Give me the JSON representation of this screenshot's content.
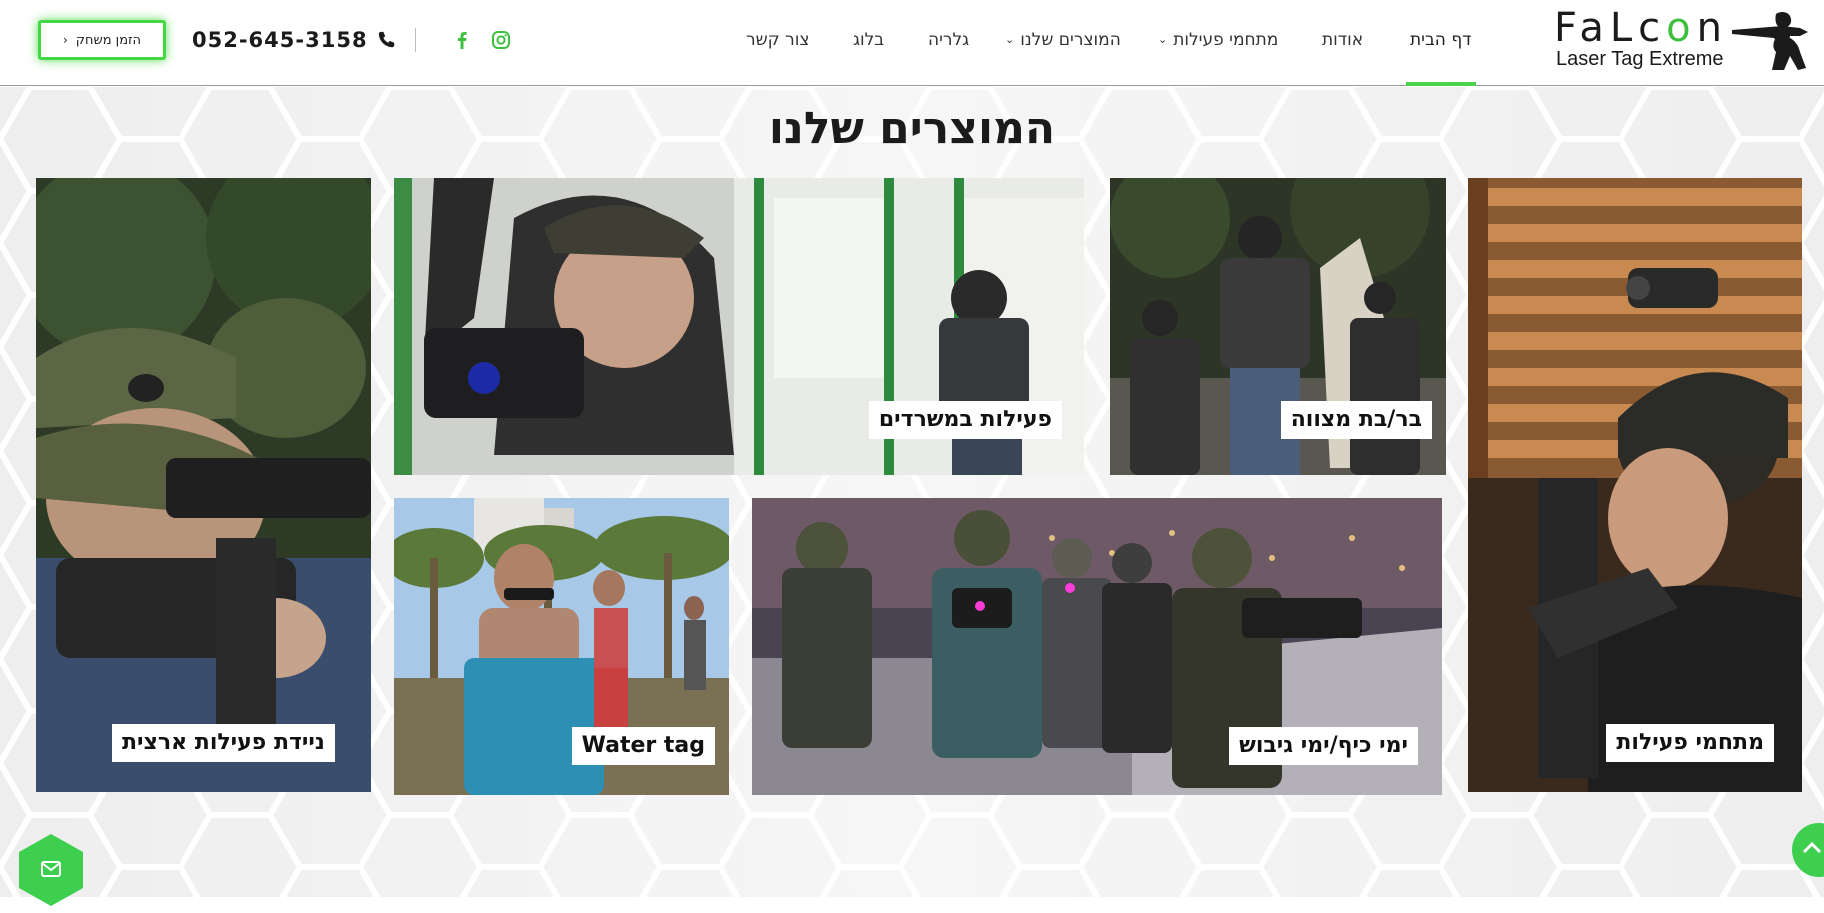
{
  "brand": {
    "logo_word": "FaLcon",
    "tagline": "Laser Tag Extreme",
    "accent_color": "#44d744"
  },
  "nav": {
    "home": "דף הבית",
    "about": "אודות",
    "activities": "מתחמי פעילות",
    "products": "המוצרים שלנו",
    "gallery": "גלריה",
    "blog": "בלוג",
    "contact": "צור קשר"
  },
  "header": {
    "phone": "052-645-3158",
    "book_button": "הזמן משחק",
    "social": [
      "instagram-icon",
      "facebook-icon"
    ]
  },
  "section": {
    "title": "המוצרים שלנו"
  },
  "tiles": [
    {
      "label": "מתחמי פעילות"
    },
    {
      "label": "בר/בת מצווה"
    },
    {
      "label": "פעילות במשרדים"
    },
    {
      "label": "ניידת פעילות ארצית"
    },
    {
      "label": "ימי כיף/ימי גיבוש"
    },
    {
      "label": "Water tag"
    }
  ],
  "floating": {
    "mail": "mail-icon",
    "scroll_top": "arrow-up-icon"
  }
}
